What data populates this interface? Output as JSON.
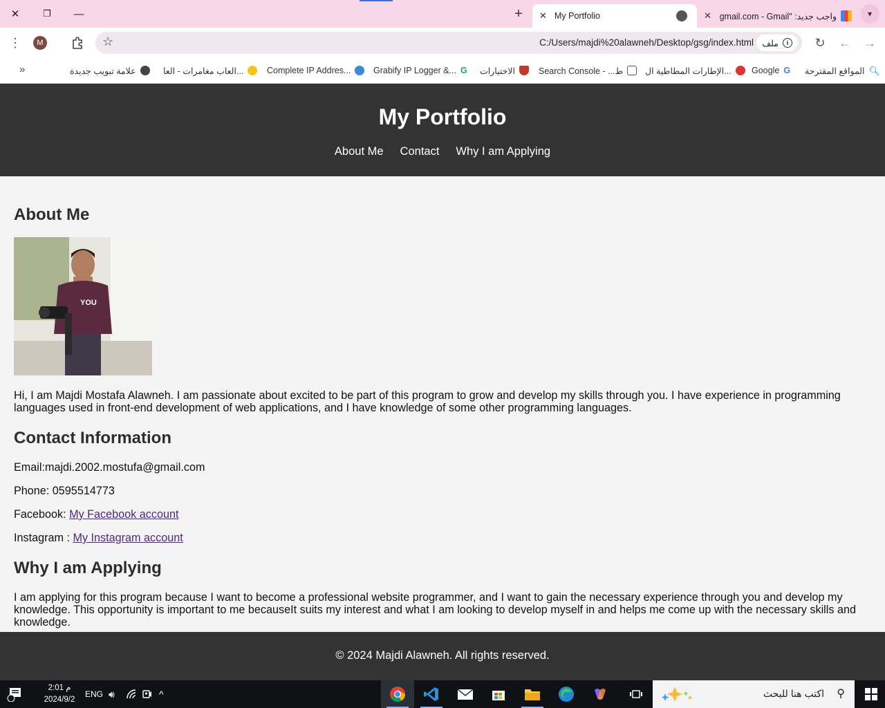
{
  "browser": {
    "tabs": [
      {
        "title": "My Portfolio",
        "active": true
      },
      {
        "title": "واجب جديد: \"gmail.com - Gmail\"",
        "active": false
      }
    ],
    "url": "C:/Users/majdi%20alawneh/Desktop/gsg/index.html",
    "site_chip": "ملف",
    "profile_initial": "M",
    "bookmarks": [
      {
        "label": "المواقع المقترحة",
        "icon": "search-icon"
      },
      {
        "label": "Google",
        "icon": "google-icon"
      },
      {
        "label": "الإطارات المطاطية ال...",
        "icon": "tire-icon"
      },
      {
        "label": "Search Console - ...ط",
        "icon": "console-icon"
      },
      {
        "label": "الاختيارات",
        "icon": "bookmark-icon"
      },
      {
        "label": "Grabify IP Logger &...",
        "icon": "grabify-icon"
      },
      {
        "label": "Complete IP Addres...",
        "icon": "globe-icon"
      },
      {
        "label": "العاب مغامرات - العا...",
        "icon": "emoji-icon"
      },
      {
        "label": "علامة تبويب جديدة",
        "icon": "globe-icon"
      }
    ]
  },
  "page": {
    "title": "My Portfolio",
    "nav": [
      "About Me",
      "Contact",
      "Why I am Applying"
    ],
    "about": {
      "heading": "About Me",
      "photo_text": "YOU",
      "text": "Hi, I am Majdi Mostafa Alawneh. I am passionate about excited to be part of this program to grow and develop my skills through you. I have experience in programming languages used in front-end development of web applications, and I have knowledge of some other programming languages."
    },
    "contact": {
      "heading": "Contact Information",
      "email": "Email:majdi.2002.mostufa@gmail.com",
      "phone": "Phone: 0595514773",
      "facebook_label": "Facebook: ",
      "facebook_link": "My Facebook account",
      "instagram_label": "Instagram : ",
      "instagram_link": "My Instagram account"
    },
    "why": {
      "heading": "Why I am Applying",
      "text": "I am applying for this program because I want to become a professional website programmer, and I want to gain the necessary experience through you and develop my knowledge. This opportunity is important to me becauseIt suits my interest and what I am looking to develop myself in and helps me come up with the necessary skills and knowledge."
    },
    "footer": "© 2024 Majdi Alawneh. All rights reserved."
  },
  "taskbar": {
    "search_placeholder": "اكتب هنا للبحث",
    "language": "ENG",
    "time": "2:01 م",
    "date": "2024/9/2"
  }
}
